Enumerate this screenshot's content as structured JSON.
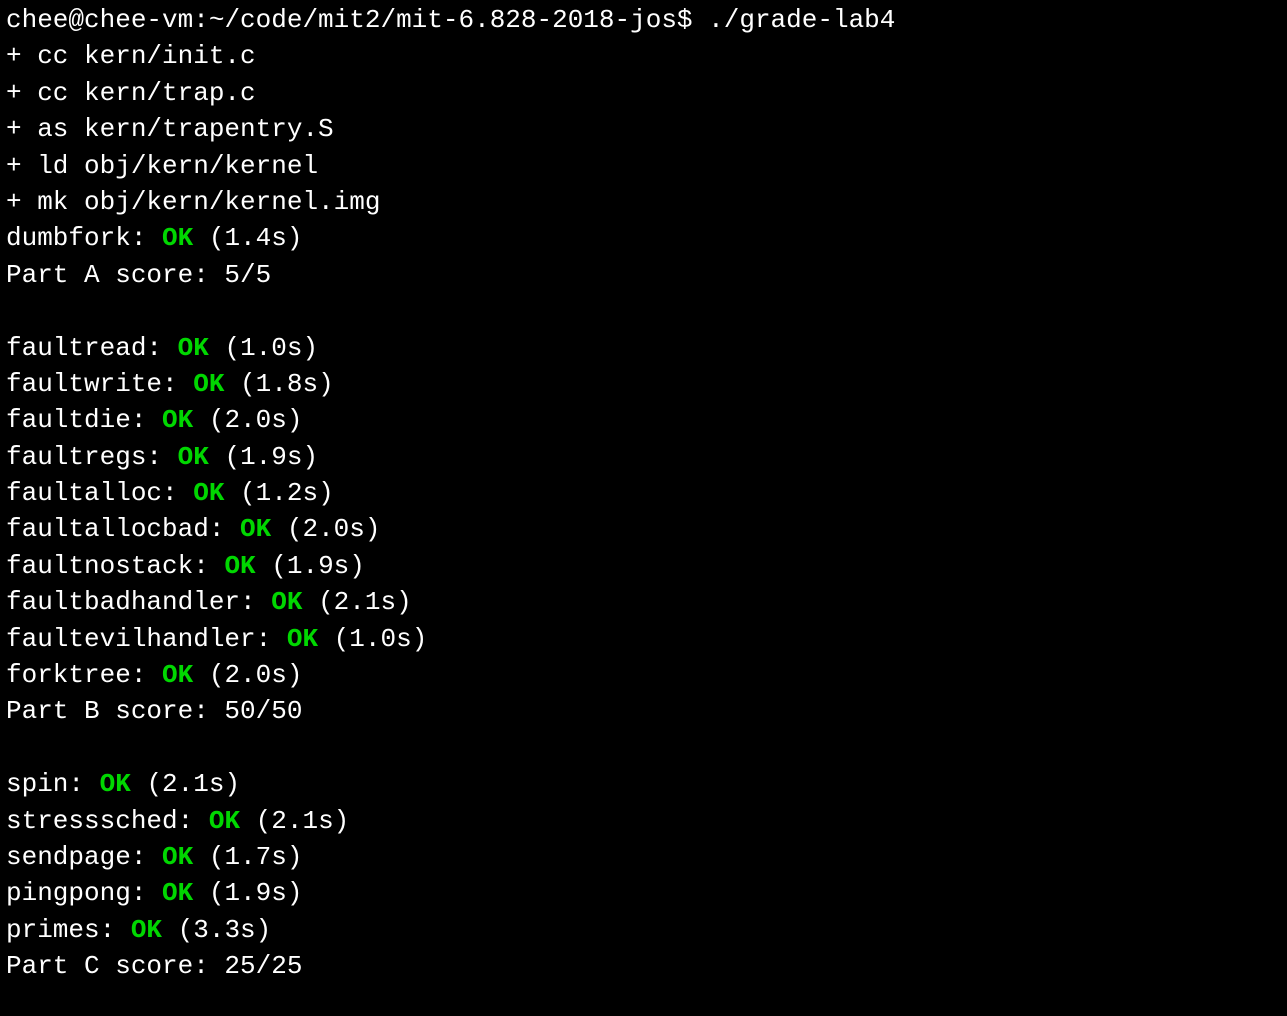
{
  "prompt": {
    "user_host": "chee@chee-vm",
    "separator": ":",
    "path": "~/code/mit2/mit-6.828-2018-jos",
    "dollar": "$",
    "command": "./grade-lab4"
  },
  "build_lines": [
    "+ cc kern/init.c",
    "+ cc kern/trap.c",
    "+ as kern/trapentry.S",
    "+ ld obj/kern/kernel",
    "+ mk obj/kern/kernel.img"
  ],
  "sections": [
    {
      "tests": [
        {
          "name": "dumbfork",
          "status": "OK",
          "time": "(1.4s)"
        }
      ],
      "score_line": "Part A score: 5/5"
    },
    {
      "tests": [
        {
          "name": "faultread",
          "status": "OK",
          "time": "(1.0s)"
        },
        {
          "name": "faultwrite",
          "status": "OK",
          "time": "(1.8s)"
        },
        {
          "name": "faultdie",
          "status": "OK",
          "time": "(2.0s)"
        },
        {
          "name": "faultregs",
          "status": "OK",
          "time": "(1.9s)"
        },
        {
          "name": "faultalloc",
          "status": "OK",
          "time": "(1.2s)"
        },
        {
          "name": "faultallocbad",
          "status": "OK",
          "time": "(2.0s)"
        },
        {
          "name": "faultnostack",
          "status": "OK",
          "time": "(1.9s)"
        },
        {
          "name": "faultbadhandler",
          "status": "OK",
          "time": "(2.1s)"
        },
        {
          "name": "faultevilhandler",
          "status": "OK",
          "time": "(1.0s)"
        },
        {
          "name": "forktree",
          "status": "OK",
          "time": "(2.0s)"
        }
      ],
      "score_line": "Part B score: 50/50"
    },
    {
      "tests": [
        {
          "name": "spin",
          "status": "OK",
          "time": "(2.1s)"
        },
        {
          "name": "stresssched",
          "status": "OK",
          "time": "(2.1s)"
        },
        {
          "name": "sendpage",
          "status": "OK",
          "time": "(1.7s)"
        },
        {
          "name": "pingpong",
          "status": "OK",
          "time": "(1.9s)"
        },
        {
          "name": "primes",
          "status": "OK",
          "time": "(3.3s)"
        }
      ],
      "score_line": "Part C score: 25/25"
    }
  ]
}
